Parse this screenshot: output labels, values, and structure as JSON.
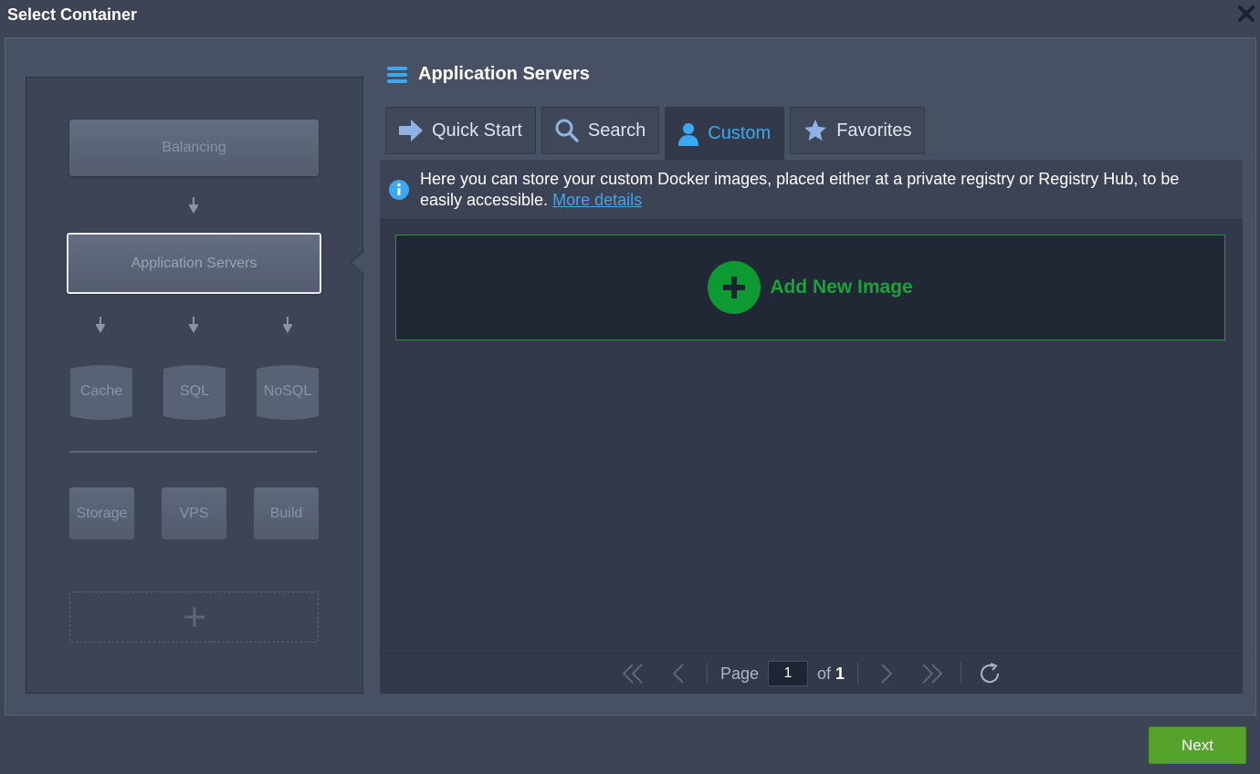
{
  "dialog": {
    "title": "Select Container"
  },
  "topology": {
    "balancing": "Balancing",
    "app_servers": "Application Servers",
    "databases": [
      "Cache",
      "SQL",
      "NoSQL"
    ],
    "extras": [
      "Storage",
      "VPS",
      "Build"
    ]
  },
  "section": {
    "title": "Application Servers"
  },
  "tabs": [
    {
      "label": "Quick Start",
      "icon": "arrow-right-icon"
    },
    {
      "label": "Search",
      "icon": "search-icon"
    },
    {
      "label": "Custom",
      "icon": "user-icon",
      "active": true
    },
    {
      "label": "Favorites",
      "icon": "star-icon"
    }
  ],
  "info": {
    "text": "Here you can store your custom Docker images, placed either at a private registry or Registry Hub, to be easily accessible.",
    "link": "More details"
  },
  "add_image": {
    "label": "Add New Image"
  },
  "pager": {
    "page_label": "Page",
    "page_value": "1",
    "of_label": "of",
    "total": "1"
  },
  "footer": {
    "next_label": "Next"
  },
  "colors": {
    "accent": "#3aa8f2",
    "add_green": "#1aa33a",
    "next_green": "#55a32b",
    "bg": "#3d4455"
  }
}
